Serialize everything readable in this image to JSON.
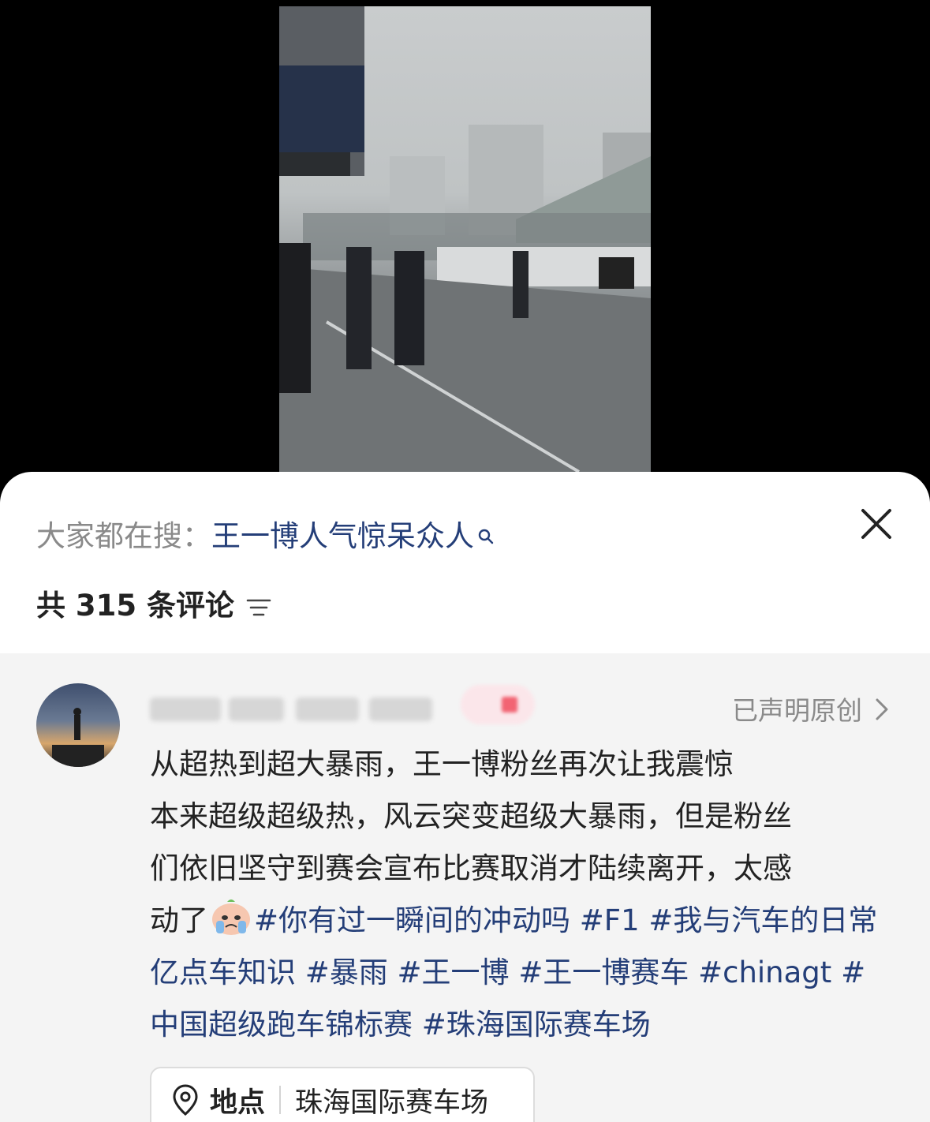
{
  "search": {
    "prefix": "大家都在搜：",
    "term": "王一博人气惊呆众人"
  },
  "comments_header": {
    "count_text": "共 315 条评论"
  },
  "post": {
    "author_name_obscured": true,
    "original_label": "已声明原创",
    "text_lines": [
      "从超热到超大暴雨，王一博粉丝再次让我震惊",
      "本来超级超级热，风云突变超级大暴雨，但是粉丝",
      "们依旧坚守到赛会宣布比赛取消才陆续离开，太感"
    ],
    "line4_plain": "动了",
    "hashtags": [
      "#你有过一瞬间的冲动吗",
      "#F1",
      "#我与汽车的日常亿点车知识",
      "#暴雨",
      "#王一博",
      "#王一博赛车",
      "#chinagt",
      "#中国超级跑车锦标赛",
      "#珠海国际赛车场"
    ]
  },
  "location": {
    "label": "地点",
    "value": "珠海国际赛车场"
  },
  "colors": {
    "link_blue": "#243e78",
    "muted_gray": "#8a8a8a",
    "sheet_bg": "#ffffff",
    "comment_bg": "#f4f4f4"
  },
  "icons": [
    "search-icon",
    "close-icon",
    "sort-icon",
    "chevron-right-icon",
    "crying-emoji-icon",
    "location-pin-icon"
  ]
}
